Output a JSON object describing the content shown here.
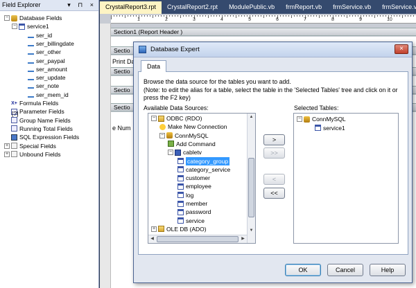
{
  "field_explorer": {
    "title": "Field Explorer",
    "title_buttons": "▾ ⊓ ×",
    "items": [
      {
        "label": "Database Fields",
        "expander": "−"
      },
      {
        "label": "service1",
        "expander": "−"
      },
      {
        "label": "ser_id"
      },
      {
        "label": "ser_billingdate"
      },
      {
        "label": "ser_other"
      },
      {
        "label": "ser_paypal"
      },
      {
        "label": "ser_amount"
      },
      {
        "label": "ser_update"
      },
      {
        "label": "ser_note"
      },
      {
        "label": "ser_mem_id"
      },
      {
        "label": "Formula Fields",
        "icon_text": "X+"
      },
      {
        "label": "Parameter Fields",
        "icon_text": "[?]"
      },
      {
        "label": "Group Name Fields"
      },
      {
        "label": "Running Total Fields"
      },
      {
        "label": "SQL Expression Fields"
      },
      {
        "label": "Special Fields",
        "expander": "+"
      },
      {
        "label": "Unbound Fields",
        "expander": "+"
      }
    ]
  },
  "tabs": [
    {
      "label": "CrystalReport3.rpt",
      "active": true
    },
    {
      "label": "CrystalReport2.rpt"
    },
    {
      "label": "ModulePublic.vb"
    },
    {
      "label": "frmReport.vb"
    },
    {
      "label": "frmService.vb"
    },
    {
      "label": "frmService.vb"
    }
  ],
  "designer": {
    "ruler_numbers": [
      "1",
      "2",
      "3",
      "4",
      "5",
      "6",
      "7",
      "8",
      "9",
      "10"
    ],
    "section1": "Section1 (Report Header )",
    "section2_partial": "Sectio",
    "print_date_partial": "Print Da",
    "sec_partial": "Sectio",
    "page_num_partial": "e Num"
  },
  "dialog": {
    "title": "Database Expert",
    "close": "×",
    "tab": "Data",
    "instruction": "Browse the data source for the tables you want to add.",
    "note": "(Note: to edit the alias for a table, select the table in the 'Selected Tables' tree and click on it or press the F2 key)",
    "available_label": "Available Data Sources:",
    "selected_label": "Selected Tables:",
    "available_tree": [
      {
        "label": "ODBC (RDO)",
        "expander": "−"
      },
      {
        "label": "Make New Connection"
      },
      {
        "label": "ConnMySQL",
        "expander": "−"
      },
      {
        "label": "Add Command"
      },
      {
        "label": "cabletv",
        "expander": "−"
      },
      {
        "label": "category_group",
        "selected": true
      },
      {
        "label": "category_service"
      },
      {
        "label": "customer"
      },
      {
        "label": "employee"
      },
      {
        "label": "log"
      },
      {
        "label": "member"
      },
      {
        "label": "password"
      },
      {
        "label": "service"
      },
      {
        "label": "OLE DB (ADO)",
        "expander": "+"
      }
    ],
    "selected_tree": [
      {
        "label": "ConnMySQL",
        "expander": "−"
      },
      {
        "label": "service1"
      }
    ],
    "move_buttons": [
      {
        "label": ">",
        "enabled": true
      },
      {
        "label": ">>",
        "enabled": false
      },
      {
        "label": "<",
        "enabled": false
      },
      {
        "label": "<<",
        "enabled": true
      }
    ],
    "ok": "OK",
    "cancel": "Cancel",
    "help": "Help"
  }
}
